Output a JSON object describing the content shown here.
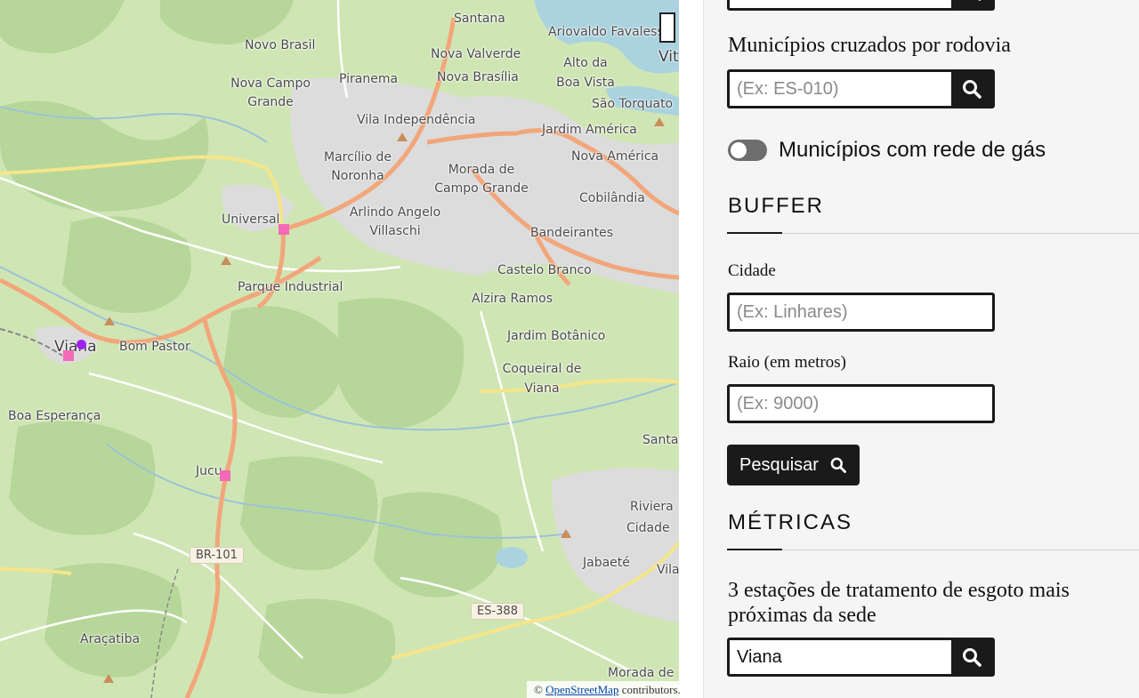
{
  "map": {
    "places": [
      {
        "name": "Santana"
      },
      {
        "name": "Ariovaldo Favalessa"
      },
      {
        "name": "Novo Brasil"
      },
      {
        "name": "Nova Valverde"
      },
      {
        "name": "Alto da Boa Vista"
      },
      {
        "name": "Nova Campo Grande"
      },
      {
        "name": "Piranema"
      },
      {
        "name": "Nova Brasília"
      },
      {
        "name": "São Torquato"
      },
      {
        "name": "Vila Independência"
      },
      {
        "name": "Jardim América"
      },
      {
        "name": "Marcílio de Noronha"
      },
      {
        "name": "Morada de Campo Grande"
      },
      {
        "name": "Nova América"
      },
      {
        "name": "Universal"
      },
      {
        "name": "Arlindo Angelo Villaschi"
      },
      {
        "name": "Cobilândia"
      },
      {
        "name": "Bandeirantes"
      },
      {
        "name": "Castelo Branco"
      },
      {
        "name": "Parque Industrial"
      },
      {
        "name": "Alzira Ramos"
      },
      {
        "name": "Jardim Botânico"
      },
      {
        "name": "Viana"
      },
      {
        "name": "Bom Pastor"
      },
      {
        "name": "Coqueiral de Viana"
      },
      {
        "name": "Boa Esperança"
      },
      {
        "name": "Jucu"
      },
      {
        "name": "Santa"
      },
      {
        "name": "Riviera"
      },
      {
        "name": "Cidade"
      },
      {
        "name": "Jabaeté"
      },
      {
        "name": "Araçatiba"
      },
      {
        "name": "Morada de"
      },
      {
        "name": "Vila"
      },
      {
        "name": "Vit"
      }
    ],
    "road_shields": [
      "BR-101",
      "ES-388"
    ],
    "attribution": {
      "prefix": "© ",
      "link": "OpenStreetMap",
      "suffix": " contributors."
    },
    "colors": {
      "marker_square": "#f46ab8",
      "marker_dot": "#a020f0",
      "land": "#cfe6b4",
      "water": "#aad3df"
    }
  },
  "panel": {
    "rodovia": {
      "label": "Municípios cruzados por rodovia",
      "placeholder": "(Ex: ES-010)",
      "button_icon": "search-icon"
    },
    "gas": {
      "label": "Municípios com rede de gás",
      "enabled": false
    },
    "buffer": {
      "title": "BUFFER",
      "city_label": "Cidade",
      "city_placeholder": "(Ex: Linhares)",
      "radius_label": "Raio (em metros)",
      "radius_placeholder": "(Ex: 9000)",
      "search_label": "Pesquisar",
      "search_icon": "search-icon"
    },
    "metricas": {
      "title": "MÉTRICAS",
      "ete_label": "3 estações de tratamento de esgoto mais próximas da sede",
      "ete_value": "Viana",
      "button_icon": "search-icon"
    }
  }
}
